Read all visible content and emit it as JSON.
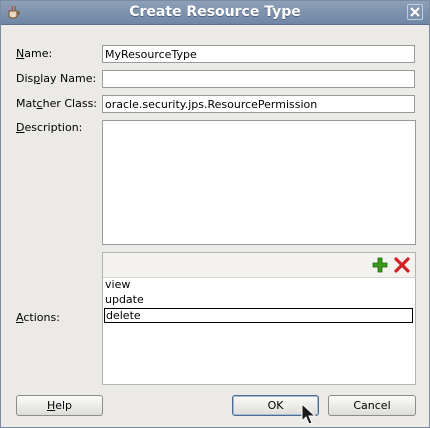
{
  "dialog": {
    "title": "Create Resource Type",
    "app_icon": "coffee-cup-icon",
    "close_icon": "close-icon"
  },
  "fields": {
    "name_label_mnemonic": "N",
    "name_label_rest": "ame:",
    "name_value": "MyResourceType",
    "display_label_pre": "Dis",
    "display_label_mnemonic": "p",
    "display_label_rest": "lay Name:",
    "display_value": "",
    "matcher_label_pre": "Mat",
    "matcher_label_mnemonic": "c",
    "matcher_label_rest": "her Class:",
    "matcher_value": "oracle.security.jps.ResourcePermission",
    "description_label_mnemonic": "D",
    "description_label_rest": "escription:",
    "description_value": ""
  },
  "actions": {
    "label_mnemonic": "A",
    "label_rest": "ctions:",
    "add_icon": "plus-icon",
    "remove_icon": "red-x-icon",
    "items": [
      "view",
      "update",
      "delete"
    ]
  },
  "buttons": {
    "help_mnemonic": "H",
    "help_rest": "elp",
    "ok": "OK",
    "cancel": "Cancel"
  },
  "colors": {
    "titlebar": "#7a8fad",
    "add_green": "#3b9a1e",
    "remove_red": "#d42020"
  }
}
